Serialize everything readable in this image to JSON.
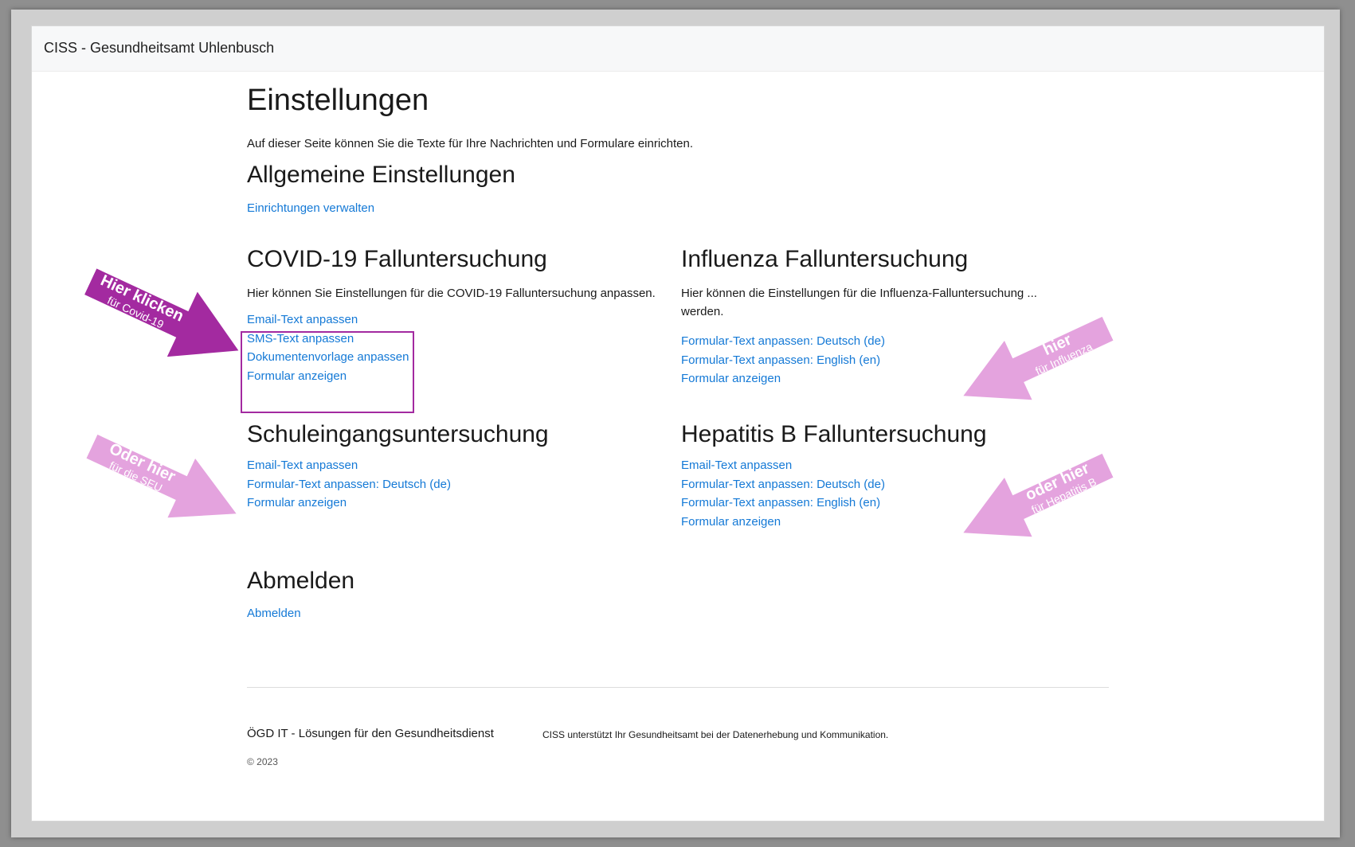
{
  "app": {
    "title": "CISS - Gesundheitsamt Uhlenbusch"
  },
  "page": {
    "title": "Einstellungen",
    "intro": "Auf dieser Seite können Sie die Texte für Ihre Nachrichten und Formulare einrichten."
  },
  "general": {
    "heading": "Allgemeine Einstellungen",
    "links": [
      "Einrichtungen verwalten"
    ]
  },
  "covid": {
    "heading": "COVID-19 Falluntersuchung",
    "description": "Hier können Sie Einstellungen für die COVID-19 Falluntersuchung anpassen.",
    "links": [
      "Email-Text anpassen",
      "SMS-Text anpassen",
      "Dokumentenvorlage anpassen",
      "Formular anzeigen"
    ]
  },
  "influenza": {
    "heading": "Influenza Falluntersuchung",
    "description": "Hier können die Einstellungen für die Influenza-Falluntersuchung ... werden.",
    "links": [
      "Formular-Text anpassen: Deutsch (de)",
      "Formular-Text anpassen: English (en)",
      "Formular anzeigen"
    ]
  },
  "seu": {
    "heading": "Schuleingangsuntersuchung",
    "links": [
      "Email-Text anpassen",
      "Formular-Text anpassen: Deutsch (de)",
      "Formular anzeigen"
    ]
  },
  "hepatitis": {
    "heading": "Hepatitis B Falluntersuchung",
    "links": [
      "Email-Text anpassen",
      "Formular-Text anpassen: Deutsch (de)",
      "Formular-Text anpassen: English (en)",
      "Formular anzeigen"
    ]
  },
  "logout": {
    "heading": "Abmelden",
    "links": [
      "Abmelden"
    ]
  },
  "footer": {
    "company": "ÖGD IT - Lösungen für den Gesundheitsdienst",
    "tagline": "CISS unterstützt Ihr Gesundheitsamt bei der Datenerhebung und Kommunikation.",
    "copyright": "© 2023"
  },
  "annotations": {
    "covid": {
      "title": "Hier klicken",
      "subtitle": "für Covid-19"
    },
    "seu": {
      "title": "Oder hier",
      "subtitle": "für die SEU"
    },
    "influenza": {
      "title": "hier",
      "subtitle": "für Influenza"
    },
    "hepatitis": {
      "title": "oder hier",
      "subtitle": "für Hepatitis B"
    }
  },
  "colors": {
    "link": "#1479d6",
    "highlight_border": "#a32aa0",
    "arrow_dark": "#a32aa0",
    "arrow_light": "#e4a3de"
  }
}
